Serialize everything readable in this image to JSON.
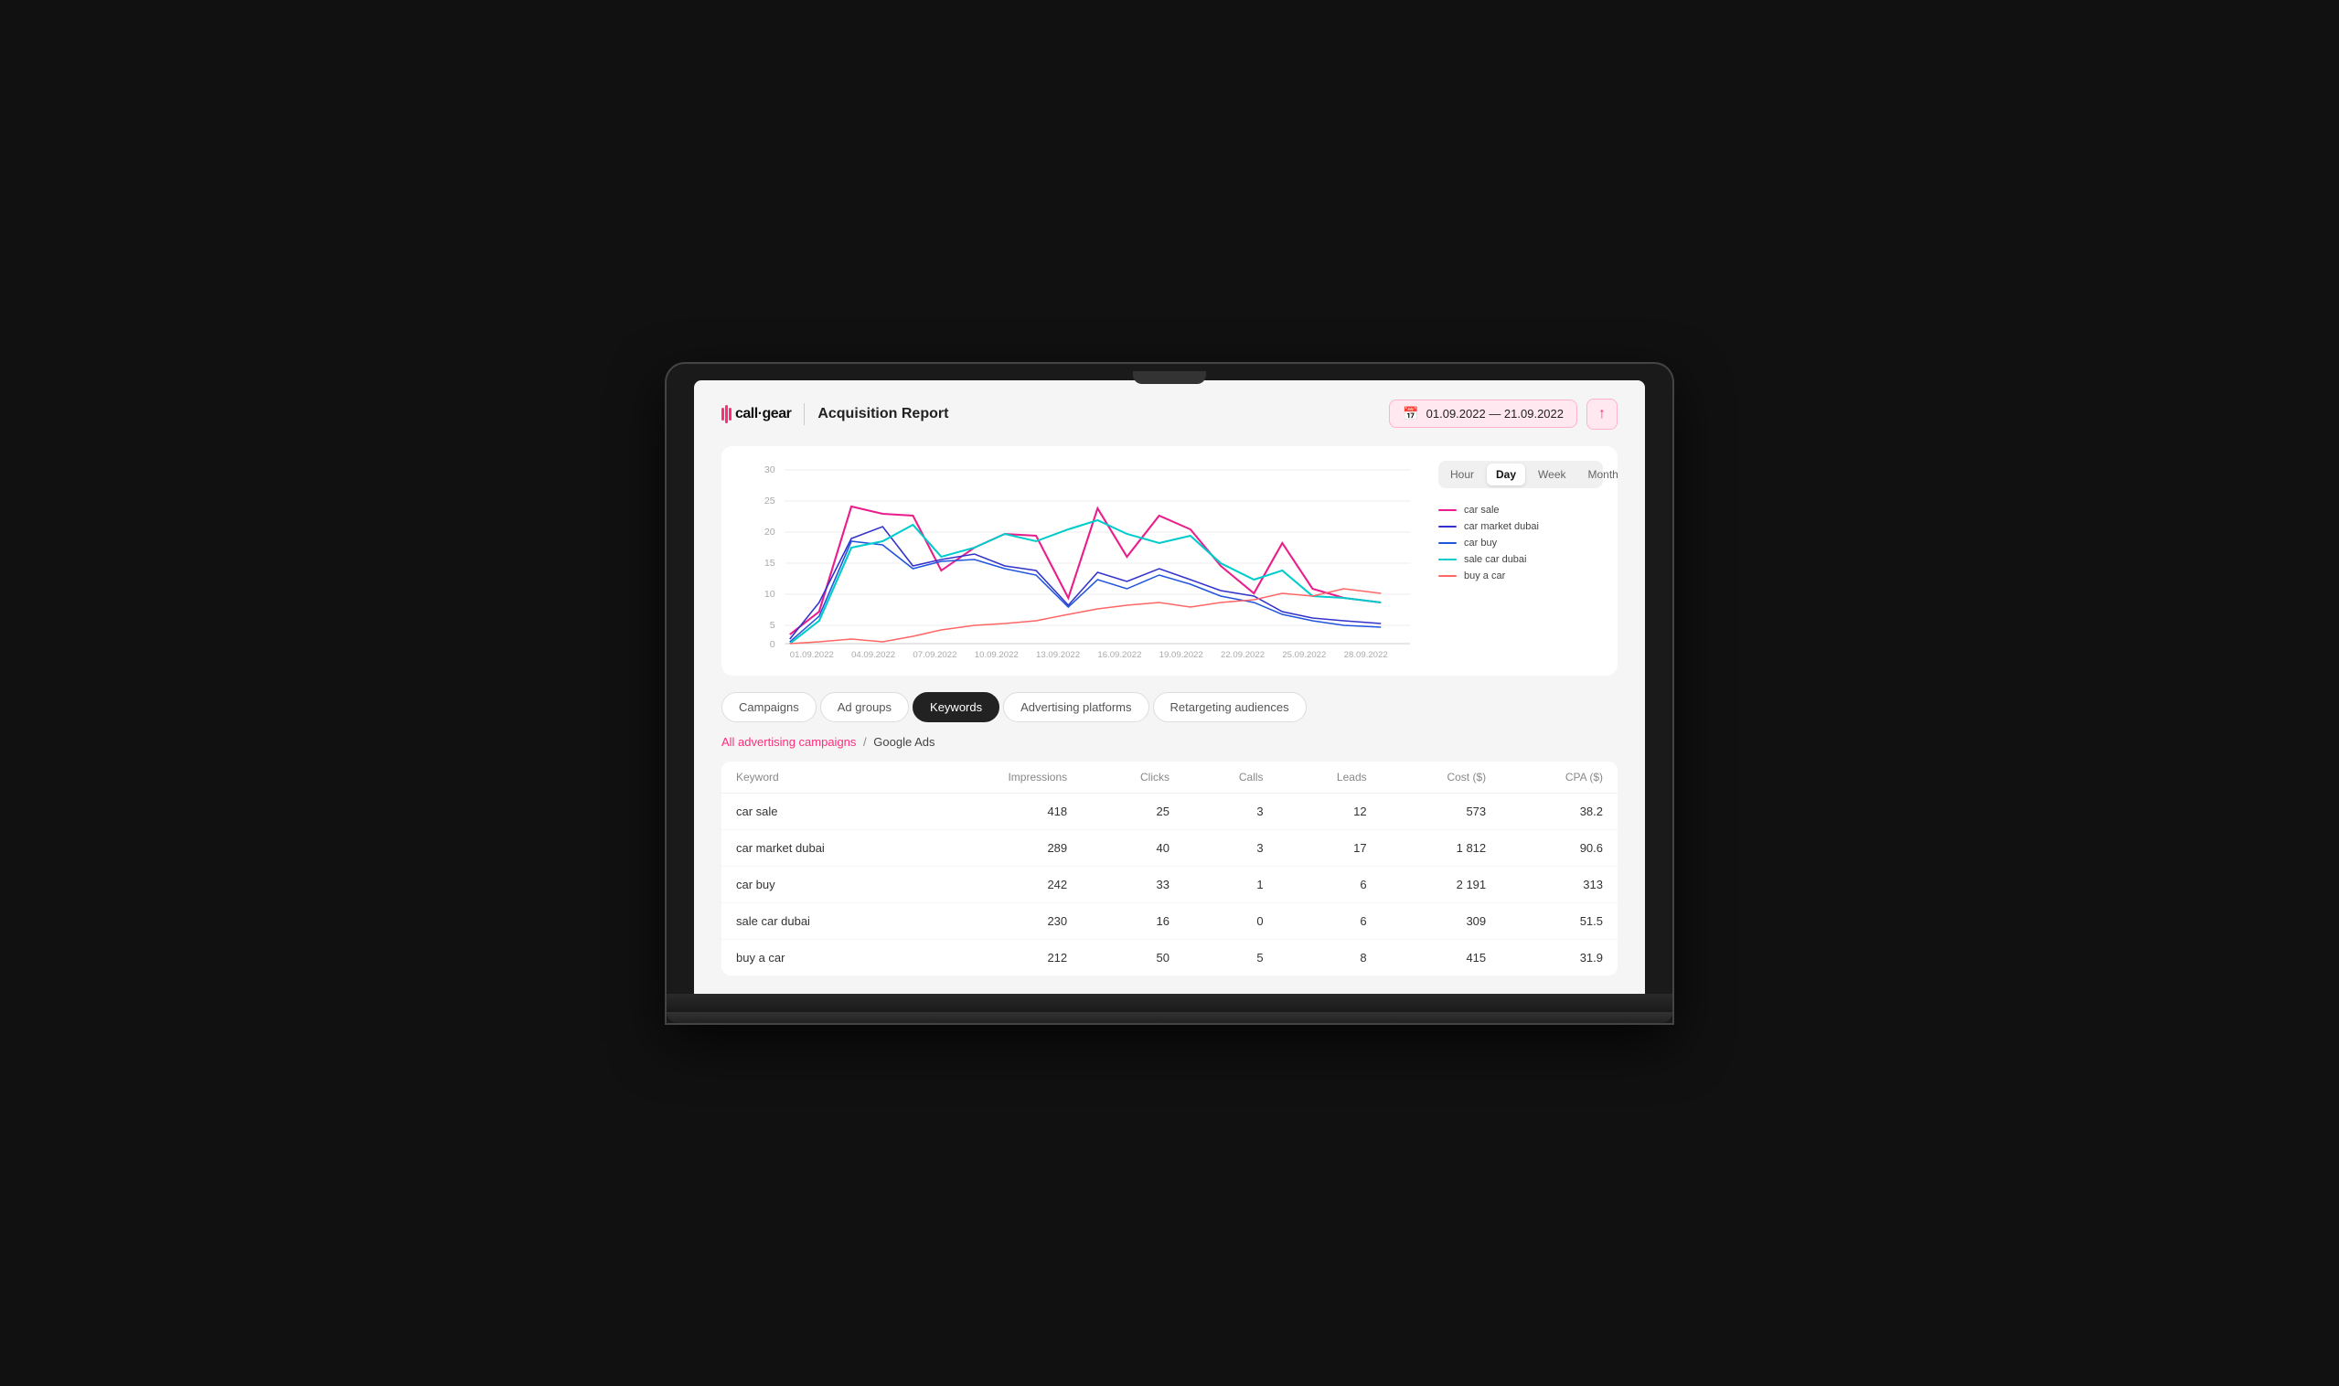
{
  "header": {
    "logo_text": "call·gear",
    "page_title": "Acquisition Report",
    "date_range": "01.09.2022 — 21.09.2022"
  },
  "chart": {
    "y_labels": [
      "0",
      "5",
      "10",
      "15",
      "20",
      "25",
      "30"
    ],
    "x_labels": [
      "01.09.2022",
      "04.09.2022",
      "07.09.2022",
      "10.09.2022",
      "13.09.2022",
      "16.09.2022",
      "19.09.2022",
      "22.09.2022",
      "25.09.2022",
      "28.09.2022"
    ],
    "time_buttons": [
      "Hour",
      "Day",
      "Week",
      "Month"
    ],
    "active_time": "Day",
    "legend": [
      {
        "name": "car sale",
        "color": "#e91e8c"
      },
      {
        "name": "car market dubai",
        "color": "#3333cc"
      },
      {
        "name": "car buy",
        "color": "#1111aa"
      },
      {
        "name": "sale car dubai",
        "color": "#00cccc"
      },
      {
        "name": "buy a car",
        "color": "#ff6666"
      }
    ]
  },
  "tabs": [
    {
      "label": "Campaigns",
      "active": false
    },
    {
      "label": "Ad groups",
      "active": false
    },
    {
      "label": "Keywords",
      "active": true
    },
    {
      "label": "Advertising platforms",
      "active": false
    },
    {
      "label": "Retargeting audiences",
      "active": false
    }
  ],
  "breadcrumb": {
    "link_text": "All advertising campaigns",
    "separator": "/",
    "current": "Google Ads"
  },
  "table": {
    "columns": [
      "Keyword",
      "Impressions",
      "Clicks",
      "Calls",
      "Leads",
      "Cost ($)",
      "CPA ($)"
    ],
    "rows": [
      {
        "keyword": "car sale",
        "impressions": "418",
        "clicks": "25",
        "calls": "3",
        "leads": "12",
        "cost": "573",
        "cpa": "38.2"
      },
      {
        "keyword": "car market dubai",
        "impressions": "289",
        "clicks": "40",
        "calls": "3",
        "leads": "17",
        "cost": "1 812",
        "cpa": "90.6"
      },
      {
        "keyword": "car buy",
        "impressions": "242",
        "clicks": "33",
        "calls": "1",
        "leads": "6",
        "cost": "2 191",
        "cpa": "313"
      },
      {
        "keyword": "sale car dubai",
        "impressions": "230",
        "clicks": "16",
        "calls": "0",
        "leads": "6",
        "cost": "309",
        "cpa": "51.5"
      },
      {
        "keyword": "buy a car",
        "impressions": "212",
        "clicks": "50",
        "calls": "5",
        "leads": "8",
        "cost": "415",
        "cpa": "31.9"
      }
    ]
  }
}
